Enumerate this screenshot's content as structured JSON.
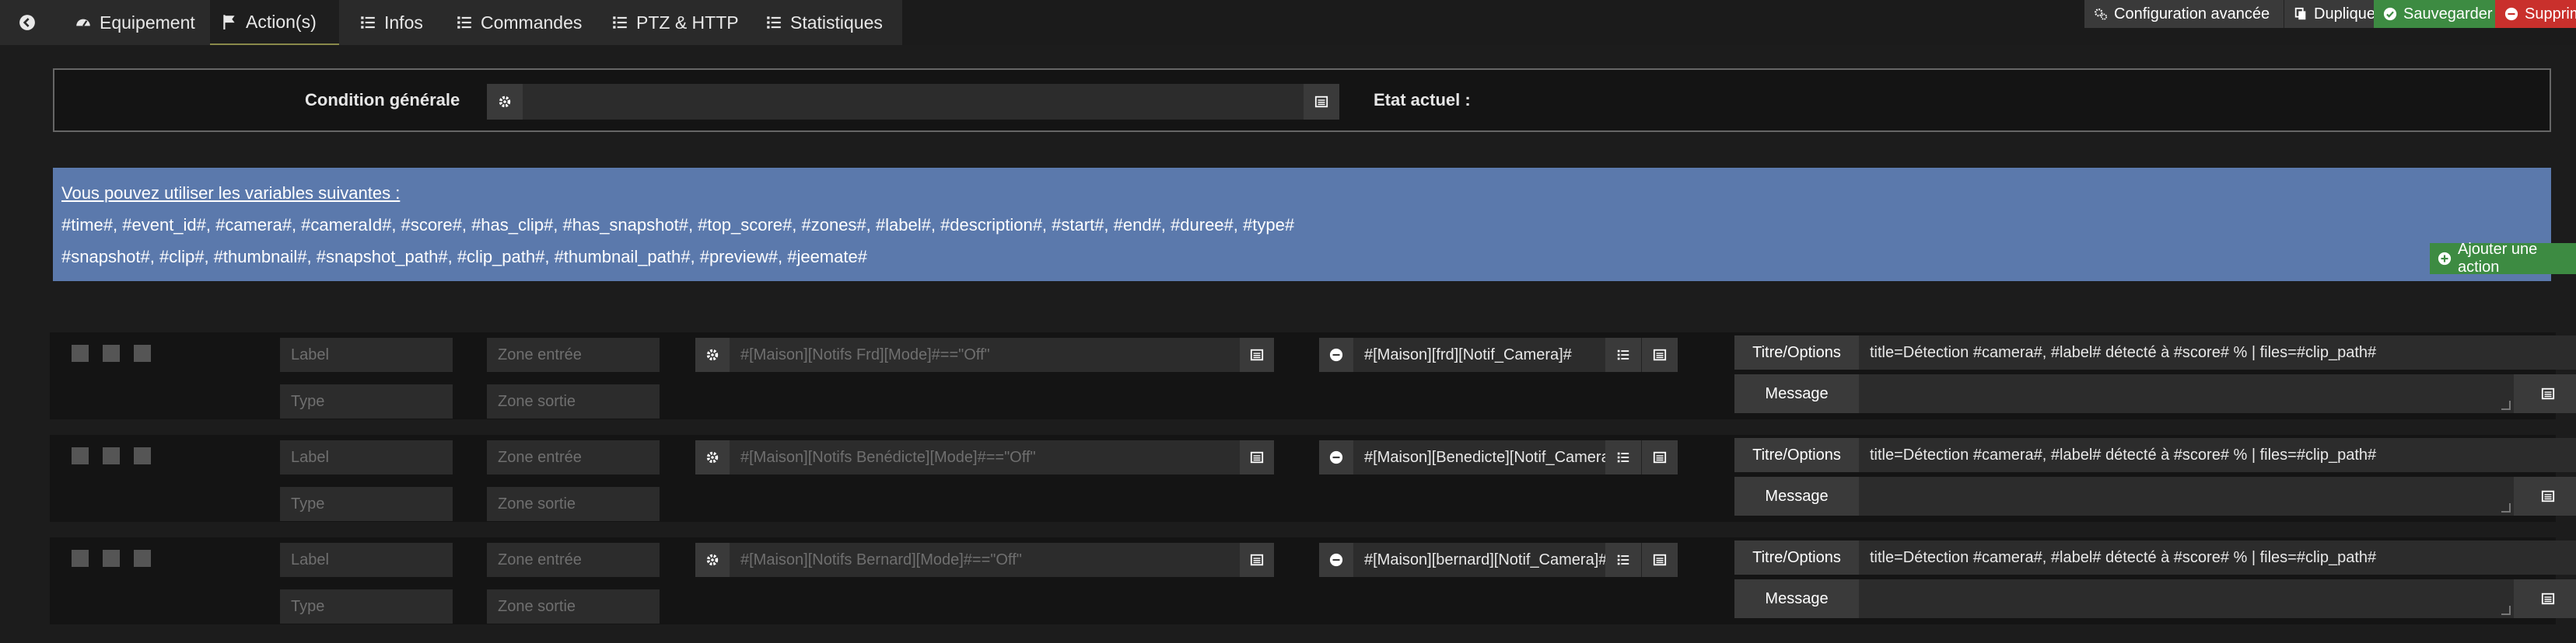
{
  "tabs": {
    "back_icon": "arrow-left-circle-icon",
    "equipement": "Equipement",
    "actions": "Action(s)",
    "infos": "Infos",
    "commandes": "Commandes",
    "ptz": "PTZ & HTTP",
    "statistiques": "Statistiques"
  },
  "toolbar": {
    "config": "Configuration avancée",
    "dupliquer": "Dupliquer",
    "sauvegarder": "Sauvegarder",
    "supprimer": "Supprim",
    "colors": {
      "dark": "#3a3a3a",
      "save": "#3d8b42",
      "delete": "#c9302c"
    }
  },
  "condition": {
    "label": "Condition générale",
    "value": "",
    "etat_label": "Etat actuel :"
  },
  "banner": {
    "title": "Vous pouvez utiliser les variables suivantes :",
    "line1": "#time#, #event_id#, #camera#, #cameraId#, #score#, #has_clip#, #has_snapshot#, #top_score#, #zones#, #label#, #description#, #start#, #end#, #duree#, #type#",
    "line2": "#snapshot#, #clip#, #thumbnail#, #snapshot_path#, #clip_path#, #thumbnail_path#, #preview#, #jeemate#",
    "add_action": "Ajouter une action",
    "color": "#5b79ac"
  },
  "actions": [
    {
      "label_ph": "Label",
      "type_ph": "Type",
      "zone_in_ph": "Zone entrée",
      "zone_out_ph": "Zone sortie",
      "condition_ph": "#[Maison][Notifs Frd][Mode]#==\"Off\"",
      "cmd": "#[Maison][frd][Notif_Camera]#",
      "titre_btn": "Titre/Options",
      "titre_val": "title=Détection #camera#, #label# détecté à #score# % | files=#clip_path#",
      "message_btn": "Message",
      "message_val": ""
    },
    {
      "label_ph": "Label",
      "type_ph": "Type",
      "zone_in_ph": "Zone entrée",
      "zone_out_ph": "Zone sortie",
      "condition_ph": "#[Maison][Notifs Benédicte][Mode]#==\"Off\"",
      "cmd": "#[Maison][Benedicte][Notif_Camera]",
      "titre_btn": "Titre/Options",
      "titre_val": "title=Détection #camera#, #label# détecté à #score# % | files=#clip_path#",
      "message_btn": "Message",
      "message_val": ""
    },
    {
      "label_ph": "Label",
      "type_ph": "Type",
      "zone_in_ph": "Zone entrée",
      "zone_out_ph": "Zone sortie",
      "condition_ph": "#[Maison][Notifs Bernard][Mode]#==\"Off\"",
      "cmd": "#[Maison][bernard][Notif_Camera]#",
      "titre_btn": "Titre/Options",
      "titre_val": "title=Détection #camera#, #label# détecté à #score# % | files=#clip_path#",
      "message_btn": "Message",
      "message_val": ""
    }
  ]
}
